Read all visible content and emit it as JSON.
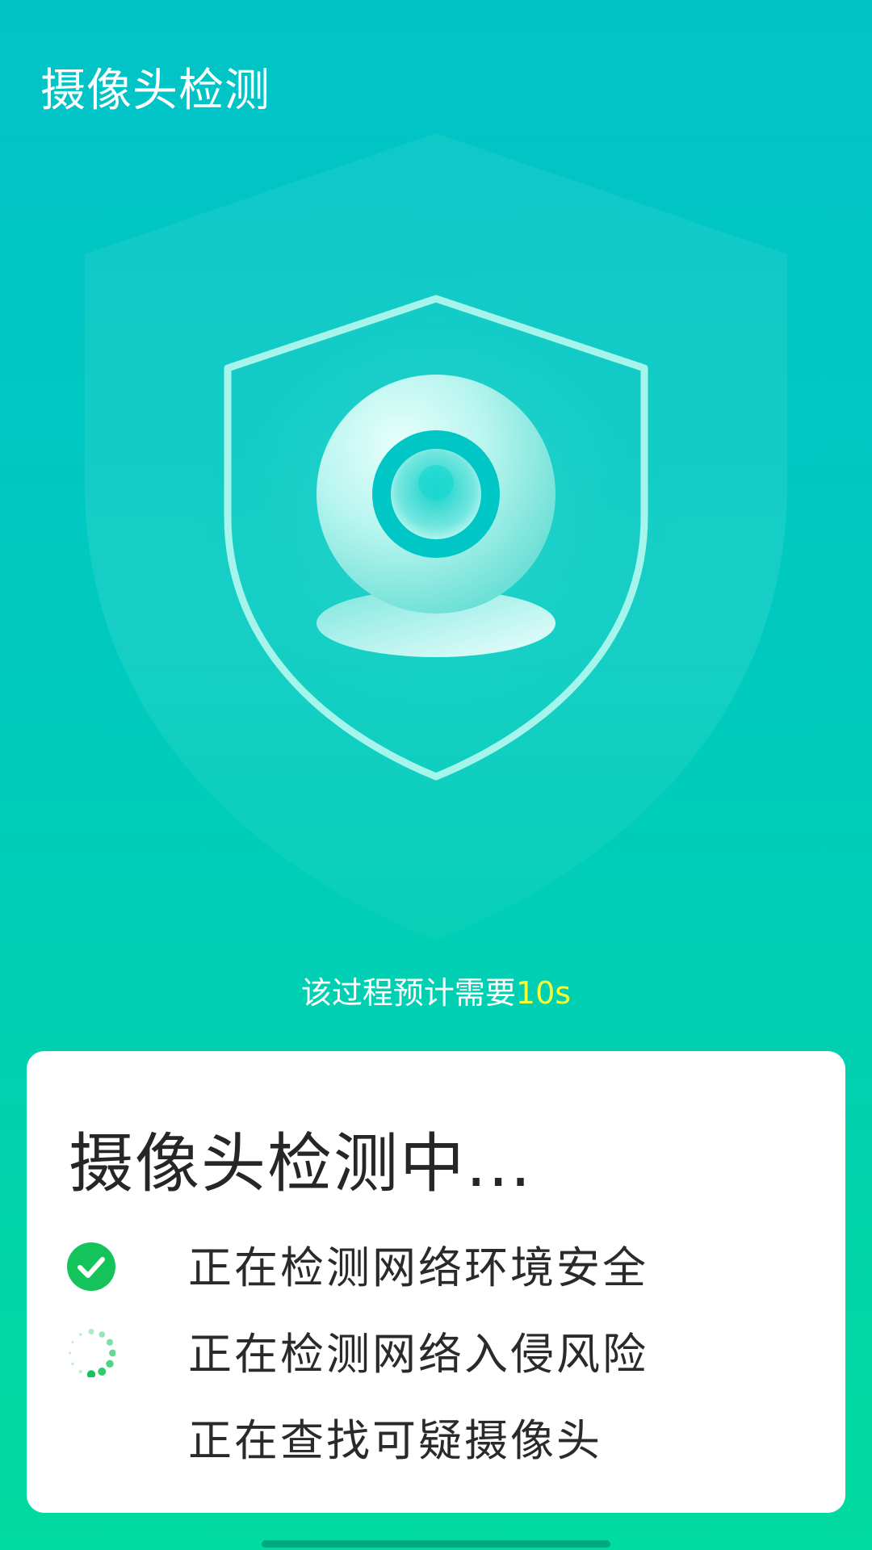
{
  "header": {
    "title": "摄像头检测"
  },
  "estimate": {
    "prefix": "该过程预计需要",
    "duration": "10s"
  },
  "card": {
    "title": "摄像头检测中...",
    "steps": [
      {
        "label": "正在检测网络环境安全",
        "status": "done",
        "icon": "check-circle-icon"
      },
      {
        "label": "正在检测网络入侵风险",
        "status": "in-progress",
        "icon": "spinner-icon"
      },
      {
        "label": "正在查找可疑摄像头",
        "status": "pending",
        "icon": "none"
      }
    ]
  },
  "colors": {
    "background_top": "#00c3c6",
    "background_bottom": "#00dba0",
    "accent_green": "#14c45a",
    "highlight_yellow": "#f2ff3a",
    "card_background": "#ffffff"
  }
}
